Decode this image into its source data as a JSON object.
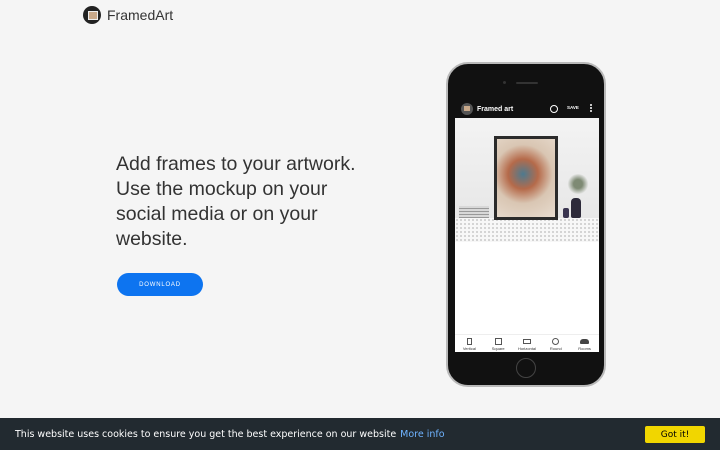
{
  "header": {
    "brand": "FramedArt"
  },
  "hero": {
    "lines": [
      "Add frames to your artwork.",
      "Use the mockup on your",
      "social media or on your",
      "website."
    ],
    "download_label": "DOWNLOAD"
  },
  "phone_app": {
    "title": "Framed art",
    "save_label": "SAVE",
    "nav": [
      {
        "label": "Vertical",
        "icon": "vertical-frame-icon"
      },
      {
        "label": "Square",
        "icon": "square-frame-icon"
      },
      {
        "label": "Horizontal",
        "icon": "horizontal-frame-icon"
      },
      {
        "label": "Round",
        "icon": "round-frame-icon"
      },
      {
        "label": "Rooms",
        "icon": "sofa-icon"
      }
    ]
  },
  "cookie": {
    "message": "This website uses cookies to ensure you get the best experience on our website",
    "link_label": "More info",
    "accept_label": "Got it!"
  },
  "colors": {
    "accent": "#0d74f0",
    "cookie_bg": "#222a30",
    "cookie_button": "#f1d600",
    "cookie_link": "#6fb3ff"
  }
}
